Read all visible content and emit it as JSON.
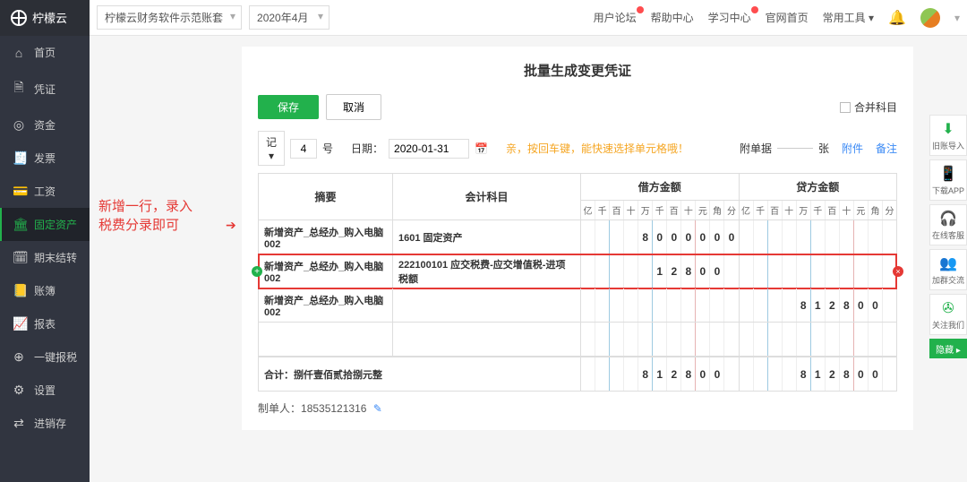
{
  "header": {
    "product": "柠檬云",
    "account_select": "柠檬云财务软件示范账套",
    "period_select": "2020年4月",
    "links": {
      "forum": "用户论坛",
      "help": "帮助中心",
      "learn": "学习中心",
      "official": "官网首页",
      "tools": "常用工具"
    }
  },
  "sidebar": {
    "items": [
      {
        "icon": "⌂",
        "label": "首页"
      },
      {
        "icon": "🗎",
        "label": "凭证"
      },
      {
        "icon": "◎",
        "label": "资金"
      },
      {
        "icon": "🧾",
        "label": "发票"
      },
      {
        "icon": "💳",
        "label": "工资"
      },
      {
        "icon": "🏛",
        "label": "固定资产"
      },
      {
        "icon": "🗓",
        "label": "期末结转"
      },
      {
        "icon": "📒",
        "label": "账簿"
      },
      {
        "icon": "📈",
        "label": "报表"
      },
      {
        "icon": "⊕",
        "label": "一键报税"
      },
      {
        "icon": "⚙",
        "label": "设置"
      },
      {
        "icon": "⇄",
        "label": "进销存"
      }
    ],
    "active_index": 5
  },
  "dock": {
    "items": [
      {
        "icon": "⬇",
        "label": "旧账导入",
        "cls": "green"
      },
      {
        "icon": "📱",
        "label": "下载APP",
        "cls": "green"
      },
      {
        "icon": "🎧",
        "label": "在线客服",
        "cls": "dark"
      },
      {
        "icon": "👥",
        "label": "加群交流",
        "cls": "dark"
      },
      {
        "icon": "✇",
        "label": "关注我们",
        "cls": "green"
      }
    ],
    "hide": "隐藏"
  },
  "panel": {
    "title": "批量生成变更凭证",
    "save": "保存",
    "cancel": "取消",
    "merge_label": "合并科目",
    "voucher_word_label": "记",
    "voucher_no": "4",
    "voucher_no_suffix": "号",
    "date_label": "日期：",
    "date_value": "2020-01-31",
    "hint": "亲，按回车键，能快速选择单元格哦！",
    "attach_label": "附单据",
    "attach_count": "",
    "attach_suffix": "张",
    "attach_link": "附件",
    "remark_link": "备注",
    "columns": {
      "summary": "摘要",
      "account": "会计科目",
      "debit": "借方金额",
      "credit": "贷方金额"
    },
    "digit_heads": [
      "亿",
      "千",
      "百",
      "十",
      "万",
      "千",
      "百",
      "十",
      "元",
      "角",
      "分"
    ],
    "rows": [
      {
        "summary": "新增资产_总经办_购入电脑002",
        "account": "1601 固定资产",
        "debit": [
          "",
          "",
          "",
          "",
          "8",
          "0",
          "0",
          "0",
          "0",
          "0",
          "0"
        ],
        "credit": [
          "",
          "",
          "",
          "",
          "",
          "",
          "",
          "",
          "",
          "",
          ""
        ]
      },
      {
        "summary": "新增资产_总经办_购入电脑002",
        "account": "222100101 应交税费-应交增值税-进项税额",
        "debit": [
          "",
          "",
          "",
          "",
          "",
          "1",
          "2",
          "8",
          "0",
          "0",
          ""
        ],
        "credit": [
          "",
          "",
          "",
          "",
          "",
          "",
          "",
          "",
          "",
          "",
          ""
        ],
        "highlight": true
      },
      {
        "summary": "新增资产_总经办_购入电脑002",
        "account": "",
        "debit": [
          "",
          "",
          "",
          "",
          "",
          "",
          "",
          "",
          "",
          "",
          ""
        ],
        "credit": [
          "",
          "",
          "",
          "",
          "8",
          "1",
          "2",
          "8",
          "0",
          "0",
          ""
        ]
      },
      {
        "summary": "",
        "account": "",
        "debit": [
          "",
          "",
          "",
          "",
          "",
          "",
          "",
          "",
          "",
          "",
          ""
        ],
        "credit": [
          "",
          "",
          "",
          "",
          "",
          "",
          "",
          "",
          "",
          "",
          ""
        ]
      }
    ],
    "total_label": "合计：捌仟壹佰贰拾捌元整",
    "total_debit": [
      "",
      "",
      "",
      "",
      "8",
      "1",
      "2",
      "8",
      "0",
      "0",
      ""
    ],
    "total_credit": [
      "",
      "",
      "",
      "",
      "8",
      "1",
      "2",
      "8",
      "0",
      "0",
      ""
    ],
    "maker_label": "制单人：",
    "maker": "18535121316"
  },
  "annotation": {
    "line1": "新增一行，录入",
    "line2": "税费分录即可"
  }
}
